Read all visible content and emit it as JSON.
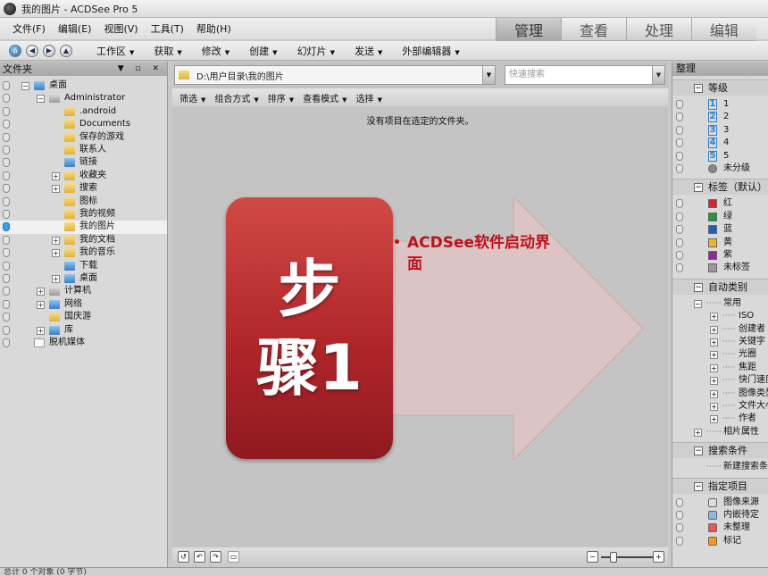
{
  "window": {
    "title": "我的图片 - ACDSee Pro 5"
  },
  "menu": {
    "items": [
      "文件(F)",
      "编辑(E)",
      "视图(V)",
      "工具(T)",
      "帮助(H)"
    ]
  },
  "mode_tabs": [
    "管理",
    "查看",
    "处理",
    "编辑"
  ],
  "toolbar": {
    "items": [
      "工作区",
      "获取",
      "修改",
      "创建",
      "幻灯片",
      "发送",
      "外部编辑器"
    ]
  },
  "left_panel": {
    "title": "文件夹",
    "tree": [
      {
        "label": "桌面",
        "level": 0,
        "exp": "−",
        "icon": "blue",
        "pin": true
      },
      {
        "label": "Administrator",
        "level": 1,
        "exp": "−",
        "icon": "gray",
        "pin": true
      },
      {
        "label": ".android",
        "level": 2,
        "exp": "",
        "icon": "folder",
        "pin": true
      },
      {
        "label": "Documents",
        "level": 2,
        "exp": "",
        "icon": "folder",
        "pin": true
      },
      {
        "label": "保存的游戏",
        "level": 2,
        "exp": "",
        "icon": "folder",
        "pin": true
      },
      {
        "label": "联系人",
        "level": 2,
        "exp": "",
        "icon": "folder",
        "pin": true
      },
      {
        "label": "链接",
        "level": 2,
        "exp": "",
        "icon": "blue",
        "pin": true
      },
      {
        "label": "收藏夹",
        "level": 2,
        "exp": "+",
        "icon": "folder",
        "pin": true
      },
      {
        "label": "搜索",
        "level": 2,
        "exp": "+",
        "icon": "folder",
        "pin": true
      },
      {
        "label": "图标",
        "level": 2,
        "exp": "",
        "icon": "folder",
        "pin": true
      },
      {
        "label": "我的视频",
        "level": 2,
        "exp": "",
        "icon": "folder",
        "pin": true
      },
      {
        "label": "我的图片",
        "level": 2,
        "exp": "",
        "icon": "folder",
        "pin": true,
        "selected": true
      },
      {
        "label": "我的文档",
        "level": 2,
        "exp": "+",
        "icon": "folder",
        "pin": true
      },
      {
        "label": "我的音乐",
        "level": 2,
        "exp": "+",
        "icon": "folder",
        "pin": true
      },
      {
        "label": "下载",
        "level": 2,
        "exp": "",
        "icon": "blue",
        "pin": true
      },
      {
        "label": "桌面",
        "level": 2,
        "exp": "+",
        "icon": "blue",
        "pin": true
      },
      {
        "label": "计算机",
        "level": 1,
        "exp": "+",
        "icon": "gray",
        "pin": true
      },
      {
        "label": "网络",
        "level": 1,
        "exp": "+",
        "icon": "blue",
        "pin": true
      },
      {
        "label": "国庆游",
        "level": 1,
        "exp": "",
        "icon": "folder",
        "pin": true
      },
      {
        "label": "库",
        "level": 1,
        "exp": "+",
        "icon": "blue",
        "pin": true
      },
      {
        "label": "脱机媒体",
        "level": 0,
        "exp": "",
        "icon": "doc",
        "pin": true
      }
    ]
  },
  "browser": {
    "path": "D:\\用户目录\\我的图片",
    "search_placeholder": "快速搜索",
    "filter_items": [
      "筛选",
      "组合方式",
      "排序",
      "查看模式",
      "选择"
    ],
    "empty_message": "没有项目在选定的文件夹。"
  },
  "slide": {
    "step_line1": "步",
    "step_line2": "骤1",
    "bullet_text": "ACDSee软件启动界面"
  },
  "right_panel": {
    "title": "整理",
    "rating_section": "等级",
    "ratings": [
      "1",
      "2",
      "3",
      "4",
      "5"
    ],
    "unrated": "未分级",
    "label_section": "标签（默认）",
    "labels": [
      {
        "name": "红",
        "color": "#d8232a"
      },
      {
        "name": "绿",
        "color": "#1e9a3b"
      },
      {
        "name": "蓝",
        "color": "#1f5fb5"
      },
      {
        "name": "黄",
        "color": "#f2b51d"
      },
      {
        "name": "紫",
        "color": "#8e2a9e"
      },
      {
        "name": "未标签",
        "color": "#9a9a9a"
      }
    ],
    "auto_section": "自动类别",
    "auto_group": "常用",
    "auto_items": [
      "ISO",
      "创建者",
      "关键字",
      "光圈",
      "焦距",
      "快门速度",
      "图像类型",
      "文件大小",
      "作者"
    ],
    "photo_props": "相片属性",
    "search_section": "搜索条件",
    "new_search": "新建搜索条件",
    "special_section": "指定项目",
    "special_items": [
      "图像来源",
      "内嵌待定",
      "未整理",
      "标记"
    ]
  },
  "status": {
    "text": "总计 0 个对象 (0 字节)"
  },
  "accent": {
    "step_red": "#b1262a",
    "bullet_red": "#c0101b",
    "arrow_fill": "#dcc4c4"
  }
}
